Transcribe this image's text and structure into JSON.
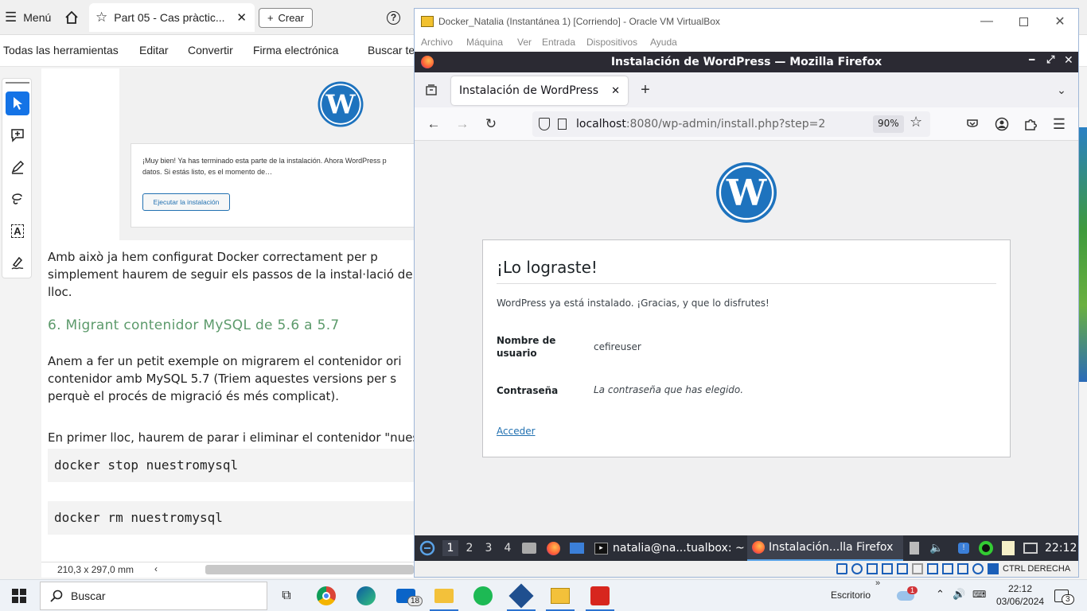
{
  "acrobat": {
    "menu_label": "Menú",
    "tab_title": "Part 05 - Cas pràctic...",
    "create_label": "Crear",
    "menubar": [
      "Todas las herramientas",
      "Editar",
      "Convertir",
      "Firma electrónica",
      "Buscar te"
    ],
    "doc": {
      "shot_text_1": "¡Muy bien! Ya has terminado esta parte de la instalación. Ahora WordPress p",
      "shot_text_2": "datos. Si estás listo, es el momento de…",
      "shot_button": "Ejecutar la instalación",
      "para1_line1": "Amb això ja hem configurat Docker correctament per p",
      "para1_line2": "simplement haurem de seguir els passos de la instal·lació de",
      "para1_line3": "lloc.",
      "heading": "6.   Migrant contenidor MySQL de 5.6 a 5.7",
      "para2_line1": "Anem a fer un petit exemple on migrarem el contenidor ori",
      "para2_line2": "contenidor amb MySQL 5.7 (Triem aquestes versions per s",
      "para2_line3": "perquè el procés de migració és més complicat).",
      "para3": "En primer lloc, haurem de parar i eliminar el contenidor \"nuest",
      "code1": "docker stop nuestromysql",
      "code2": "docker rm nuestromysql"
    },
    "status_size": "210,3 x 297,0 mm"
  },
  "vbox": {
    "title": "Docker_Natalia (Instantánea 1) [Corriendo] - Oracle VM VirtualBox",
    "menu": [
      "Archivo",
      "Máquina",
      "Ver",
      "Entrada",
      "Dispositivos",
      "Ayuda"
    ],
    "host_key": "CTRL DERECHA"
  },
  "firefox": {
    "window_title": "Instalación de WordPress — Mozilla Firefox",
    "tab_title": "Instalación de WordPress",
    "url_host": "localhost",
    "url_rest": ":8080/wp-admin/install.php?step=2",
    "zoom": "90%"
  },
  "wordpress": {
    "heading": "¡Lo lograste!",
    "message": "WordPress ya está instalado. ¡Gracias, y que lo disfrutes!",
    "username_label": "Nombre de usuario",
    "username_value": "cefireuser",
    "password_label": "Contraseña",
    "password_value": "La contraseña que has elegido.",
    "login_link": "Acceder"
  },
  "xfce_panel": {
    "workspaces": [
      "1",
      "2",
      "3",
      "4"
    ],
    "terminal_task": "natalia@na...tualbox: ~",
    "firefox_task": "Instalación...lla Firefox",
    "clock": "22:12"
  },
  "taskbar": {
    "search_placeholder": "Buscar",
    "desktop_label": "Escritorio",
    "mail_badge": "18",
    "weather_badge": "1",
    "time": "22:12",
    "date": "03/06/2024",
    "notification_count": "3"
  }
}
